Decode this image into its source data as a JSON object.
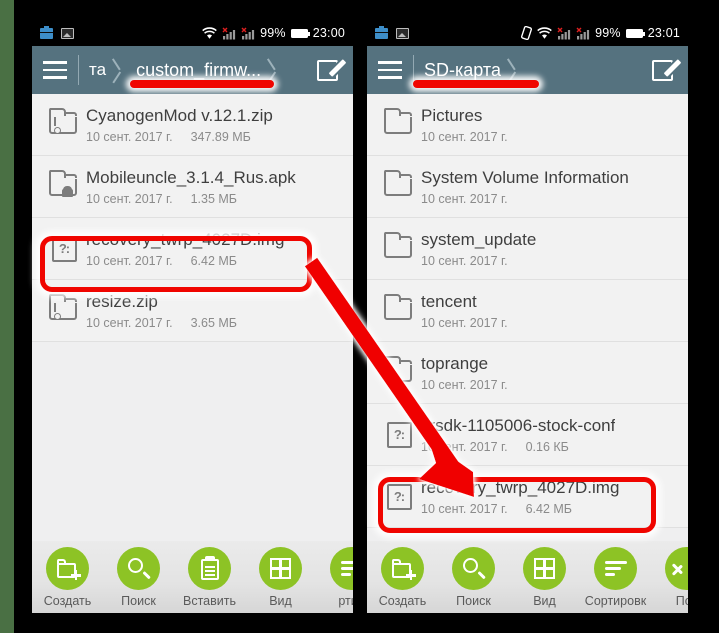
{
  "colors": {
    "appbar": "#55727f",
    "accent_green": "#8dc325",
    "annotation_red": "#f00500",
    "list_bg": "#f2f2f2",
    "edge_green": "#4a7044"
  },
  "panels": [
    {
      "id": "left",
      "statusbar": {
        "icons": [
          "briefcase-icon",
          "picture-icon"
        ],
        "wifi": "wifi-icon",
        "signals": [
          "signal-no-sim-1",
          "signal-no-sim-2"
        ],
        "battery_percent": "99%",
        "battery": "battery-icon",
        "time": "23:00"
      },
      "appbar": {
        "menu": "hamburger-icon",
        "crumbs": [
          "та",
          "custom_firmw..."
        ],
        "edit": "edit-icon"
      },
      "files": [
        {
          "name": "CyanogenMod v.12.1.zip",
          "date": "10 сент. 2017 г.",
          "size": "347.89 МБ",
          "icon": "zip-file-icon"
        },
        {
          "name": "Mobileuncle_3.1.4_Rus.apk",
          "date": "10 сент. 2017 г.",
          "size": "1.35 МБ",
          "icon": "apk-file-icon"
        },
        {
          "name": "recovery_twrp_4027D.img",
          "date": "10 сент. 2017 г.",
          "size": "6.42 МБ",
          "icon": "unknown-file-icon",
          "highlighted": true
        },
        {
          "name": "resize.zip",
          "date": "10 сент. 2017 г.",
          "size": "3.65 МБ",
          "icon": "zip-file-icon"
        }
      ],
      "bottom_buttons": [
        {
          "label": "Создать",
          "icon": "new-folder-icon"
        },
        {
          "label": "Поиск",
          "icon": "search-icon"
        },
        {
          "label": "Вставить",
          "icon": "paste-icon"
        },
        {
          "label": "Вид",
          "icon": "grid-view-icon"
        },
        {
          "label": "ртир",
          "icon": "sort-icon"
        }
      ]
    },
    {
      "id": "right",
      "statusbar": {
        "icons": [
          "briefcase-icon",
          "picture-icon"
        ],
        "vibrate": "vibrate-icon",
        "wifi": "wifi-icon",
        "signals": [
          "signal-no-sim-1",
          "signal-no-sim-2"
        ],
        "battery_percent": "99%",
        "battery": "battery-icon",
        "time": "23:01"
      },
      "appbar": {
        "menu": "hamburger-icon",
        "crumbs": [
          "SD-карта"
        ],
        "edit": "edit-icon"
      },
      "files": [
        {
          "name": "Pictures",
          "date": "10 сент. 2017 г.",
          "size": "",
          "icon": "folder-icon"
        },
        {
          "name": "System Volume Information",
          "date": "10 сент. 2017 г.",
          "size": "",
          "icon": "folder-icon"
        },
        {
          "name": "system_update",
          "date": "10 сент. 2017 г.",
          "size": "",
          "icon": "folder-icon"
        },
        {
          "name": "tencent",
          "date": "10 сент. 2017 г.",
          "size": "",
          "icon": "folder-icon"
        },
        {
          "name": "toprange",
          "date": "10 сент. 2017 г.",
          "size": "",
          "icon": "folder-icon"
        },
        {
          "name": "krsdk-1105006-stock-conf",
          "date": "10 сент. 2017 г.",
          "size": "0.16 КБ",
          "icon": "unknown-file-icon"
        },
        {
          "name": "recovery_twrp_4027D.img",
          "date": "10 сент. 2017 г.",
          "size": "6.42 МБ",
          "icon": "unknown-file-icon",
          "highlighted": true
        }
      ],
      "bottom_buttons": [
        {
          "label": "Создать",
          "icon": "new-folder-icon"
        },
        {
          "label": "Поиск",
          "icon": "search-icon"
        },
        {
          "label": "Вид",
          "icon": "grid-view-icon"
        },
        {
          "label": "Сортировк",
          "icon": "sort-icon"
        },
        {
          "label": "Пок",
          "icon": "chevron-left-icon"
        }
      ]
    }
  ],
  "annotations": {
    "arrow": "red-arrow-left-file-to-right-file",
    "underlines": [
      "left-breadcrumb-underline",
      "right-breadcrumb-underline"
    ],
    "boxes": [
      "left-file-highlight",
      "right-file-highlight"
    ]
  }
}
